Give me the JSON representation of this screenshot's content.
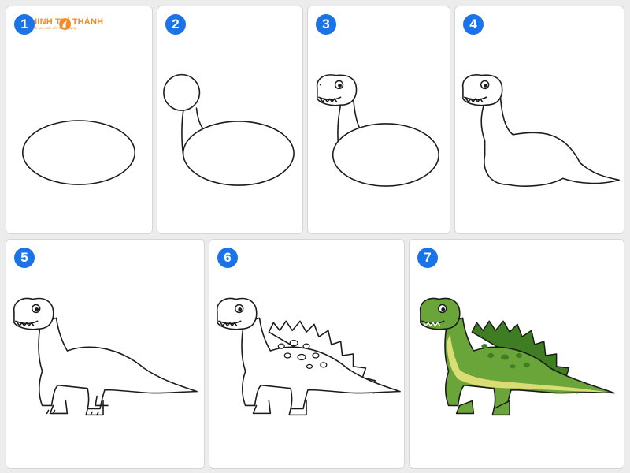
{
  "logo": {
    "name": "MINH TRÍ THÀNH",
    "tagline": "Kiến tạo cuộc đời ngoại hạng"
  },
  "steps": [
    {
      "number": "1"
    },
    {
      "number": "2"
    },
    {
      "number": "3"
    },
    {
      "number": "4"
    },
    {
      "number": "5"
    },
    {
      "number": "6"
    },
    {
      "number": "7"
    }
  ],
  "colors": {
    "badge": "#1a73e8",
    "logo": "#f28c28",
    "dino_body": "#6aa53a",
    "dino_belly": "#d9dd73",
    "dino_spots": "#3f7d22",
    "outline": "#1b1b1b"
  }
}
